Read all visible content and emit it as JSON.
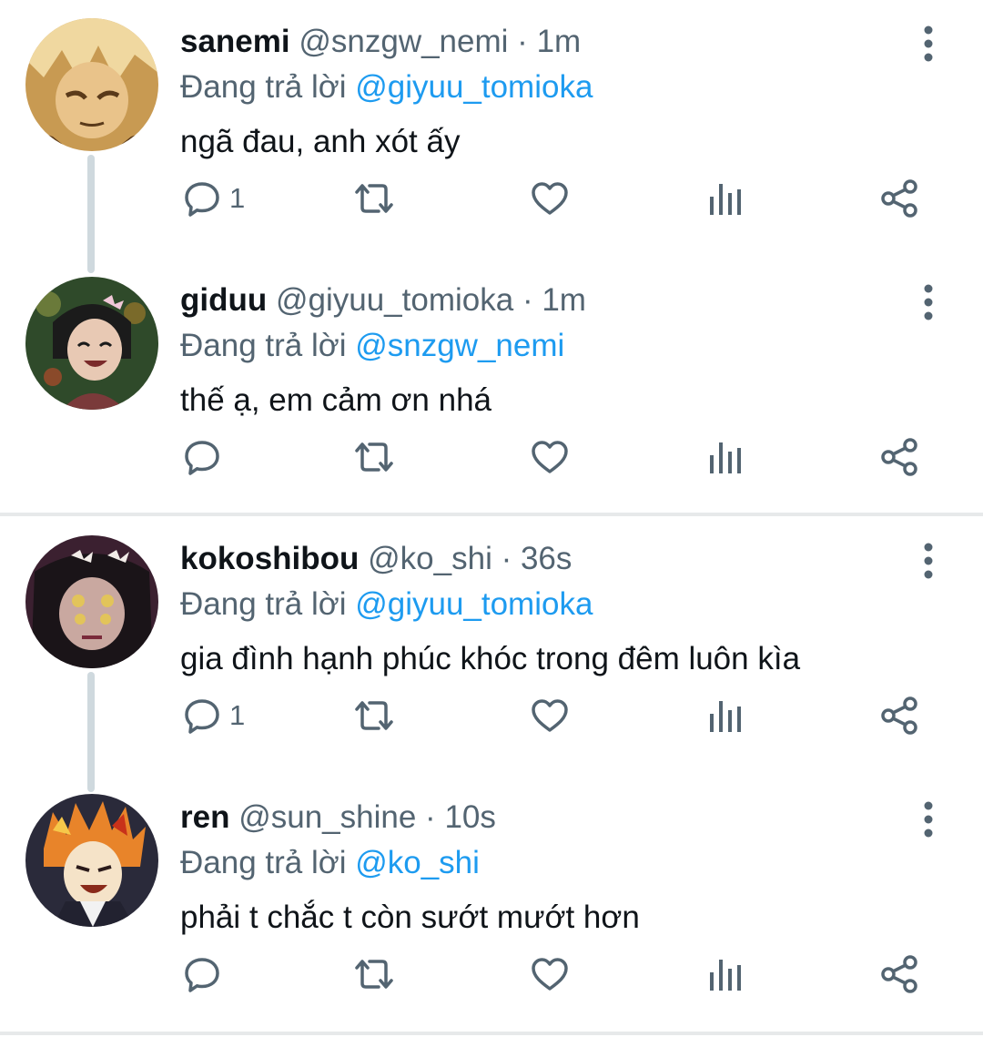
{
  "tweets": [
    {
      "display_name": "sanemi",
      "handle": "@snzgw_nemi",
      "separator": "·",
      "time": "1m",
      "reply_prefix": "Đang trả lời",
      "reply_to": "@giyuu_tomioka",
      "text": "ngã đau, anh xót ấy",
      "reply_count": "1",
      "avatar_colors": [
        "#f0d8a0",
        "#c89a52",
        "#5a3a1a"
      ]
    },
    {
      "display_name": "giduu",
      "handle": "@giyuu_tomioka",
      "separator": "·",
      "time": "1m",
      "reply_prefix": "Đang trả lời",
      "reply_to": "@snzgw_nemi",
      "text": "thế ạ, em cảm ơn nhá",
      "reply_count": "",
      "avatar_colors": [
        "#2f4a2a",
        "#1b1b1b",
        "#e8c9b4"
      ]
    },
    {
      "display_name": "kokoshibou",
      "handle": "@ko_shi",
      "separator": "·",
      "time": "36s",
      "reply_prefix": "Đang trả lời",
      "reply_to": "@giyuu_tomioka",
      "text": "gia đình hạnh phúc khóc trong đêm luôn kìa",
      "reply_count": "1",
      "avatar_colors": [
        "#3b2030",
        "#1a1418",
        "#e2c45a"
      ]
    },
    {
      "display_name": "ren",
      "handle": "@sun_shine",
      "separator": "·",
      "time": "10s",
      "reply_prefix": "Đang trả lời",
      "reply_to": "@ko_shi",
      "text": "phải t chắc t còn sướt mướt hơn",
      "reply_count": "",
      "avatar_colors": [
        "#2a2a3a",
        "#e8842a",
        "#f5e3c8"
      ]
    }
  ],
  "icons": {
    "more": "more-vertical-icon",
    "reply": "reply-icon",
    "retweet": "retweet-icon",
    "like": "heart-icon",
    "views": "views-icon",
    "share": "share-icon"
  },
  "colors": {
    "text": "#0f1419",
    "muted": "#536471",
    "link": "#1d9bf0",
    "divider": "#e7e9ea",
    "thread_line": "#cfd9de"
  }
}
